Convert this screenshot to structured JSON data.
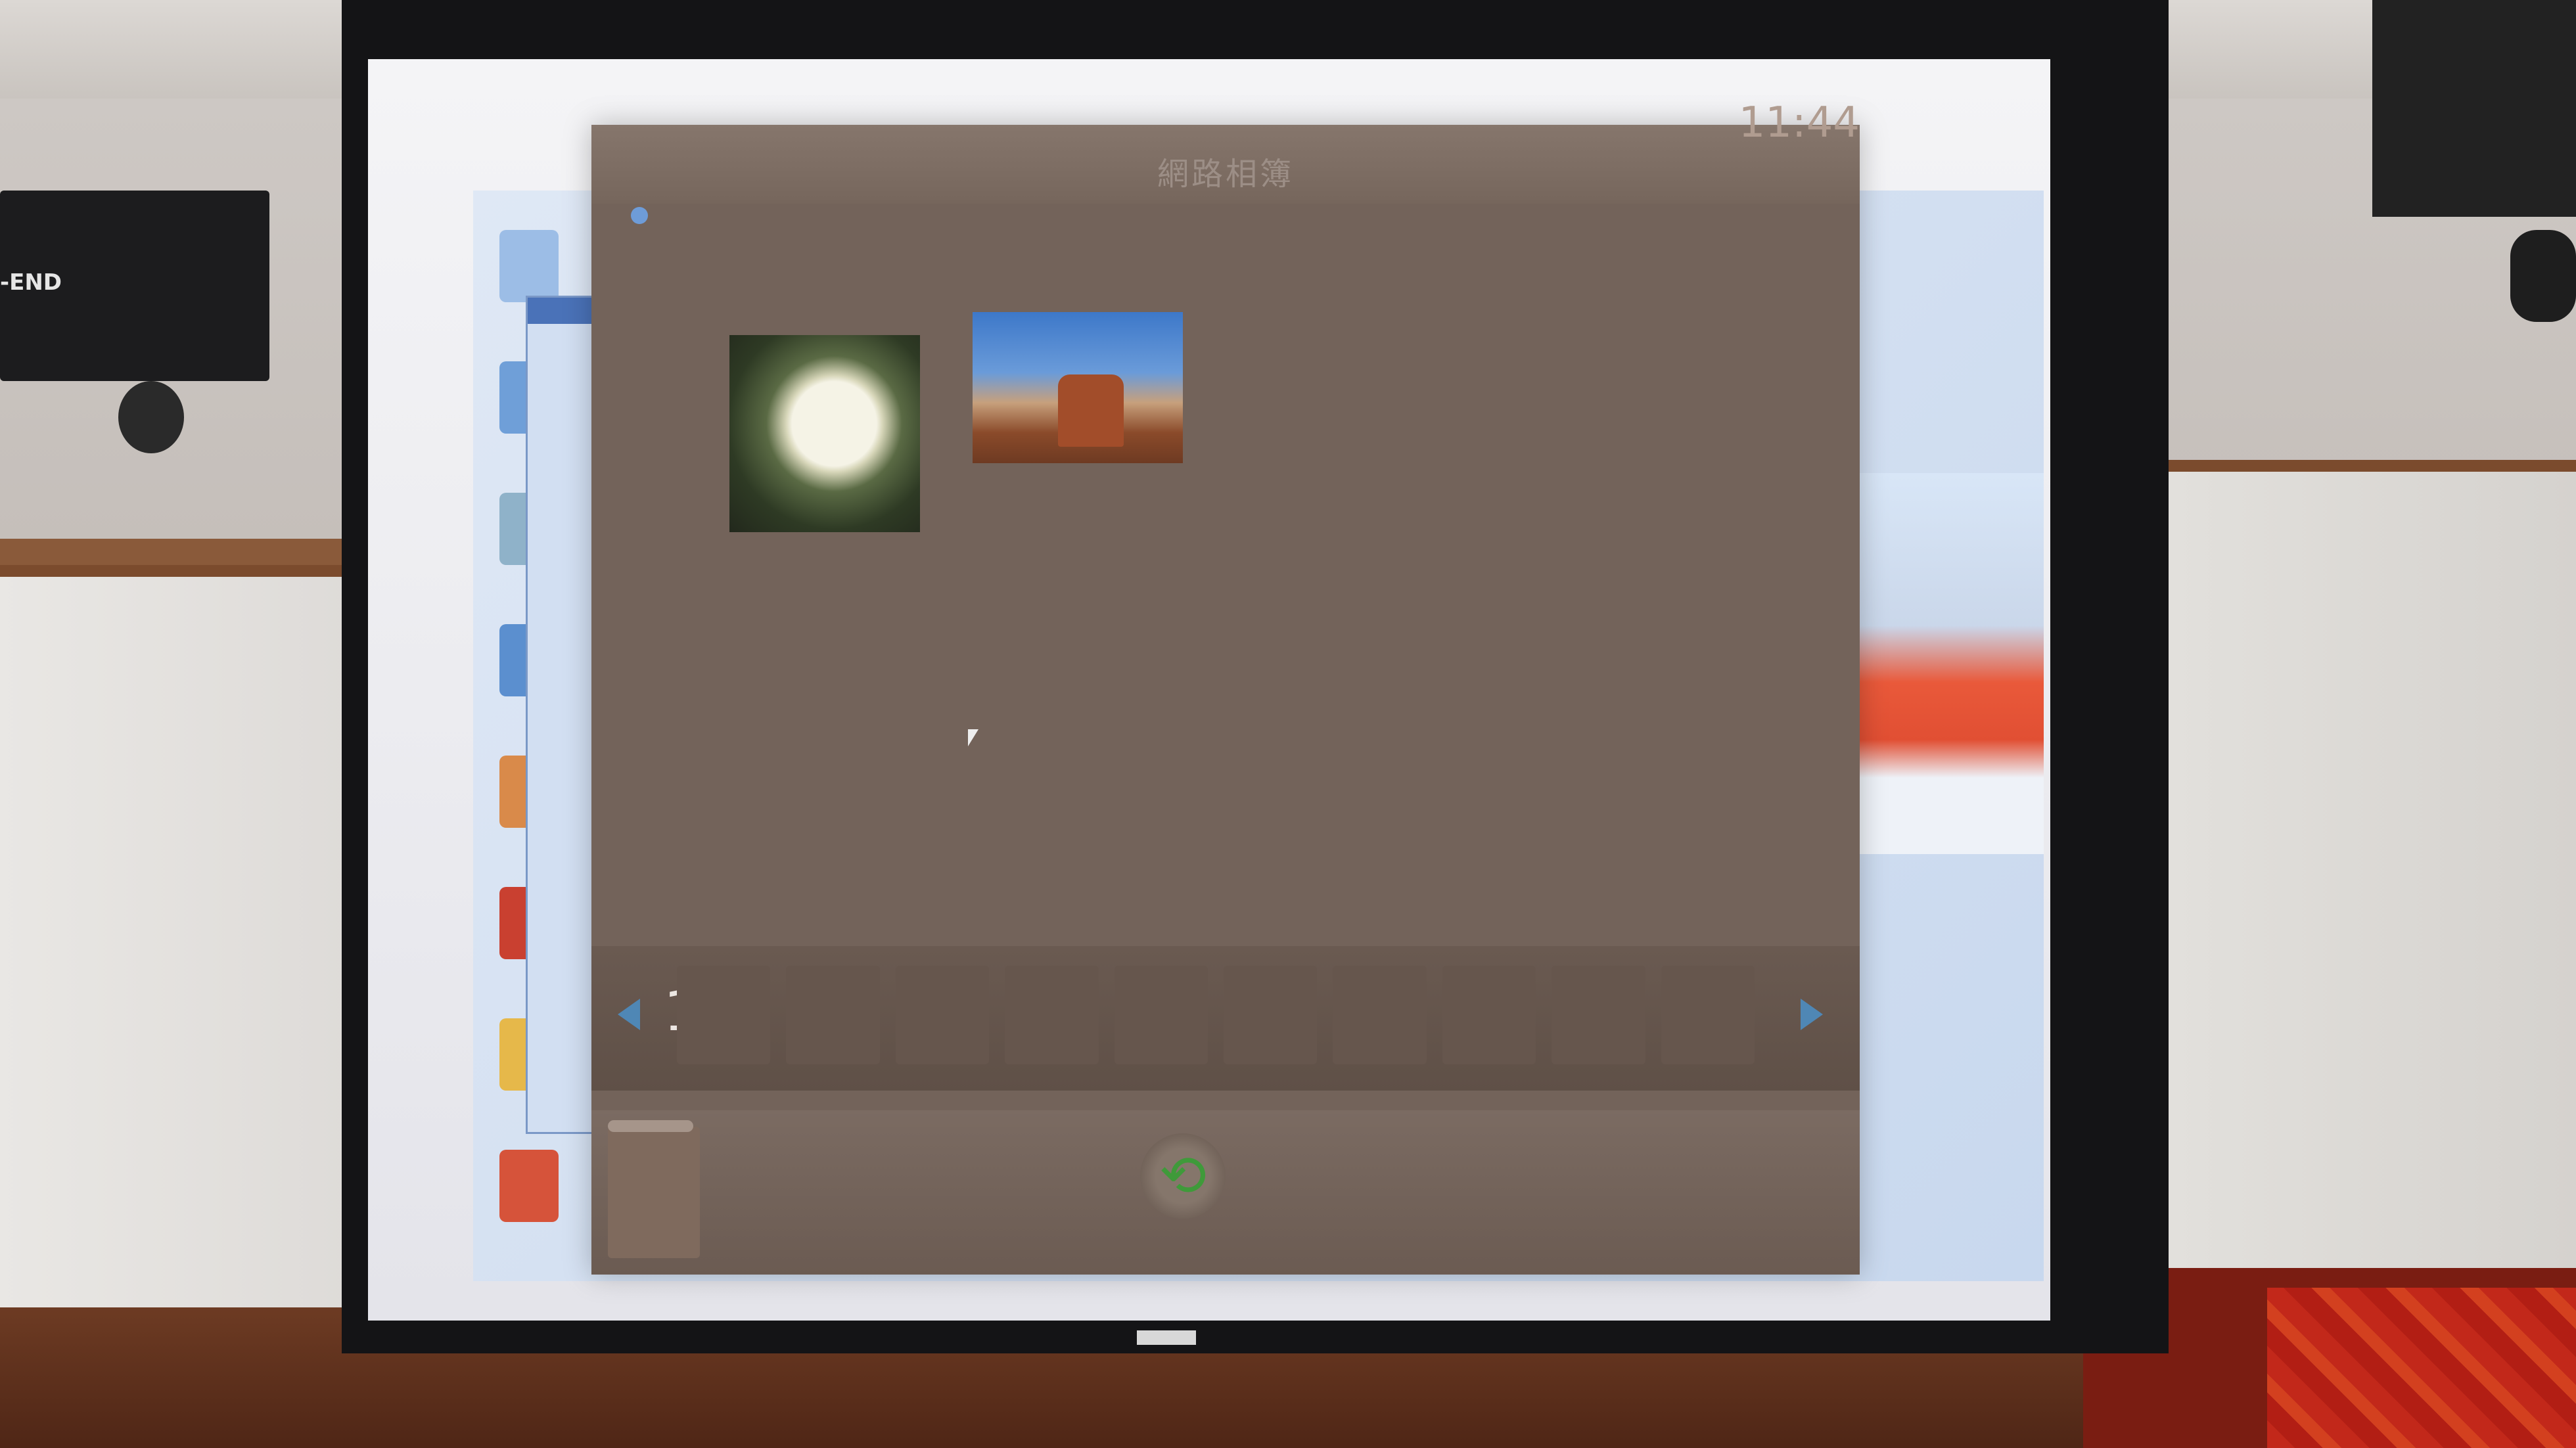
{
  "app": {
    "title": "網路相簿",
    "clock": "11:44"
  },
  "pager": {
    "current_page": "1"
  },
  "photos": [
    {
      "name": "flower-photo"
    },
    {
      "name": "desert-butte-photo"
    }
  ],
  "icons": {
    "prev": "chevron-left-icon",
    "next": "chevron-right-icon",
    "refresh": "refresh-icon",
    "refresh_glyph": "⟲"
  },
  "room": {
    "speaker_label": "-END"
  },
  "colors": {
    "app_background": "#73635a",
    "nav_arrow": "#4f87b5",
    "refresh_accent": "#3f9a3a"
  }
}
